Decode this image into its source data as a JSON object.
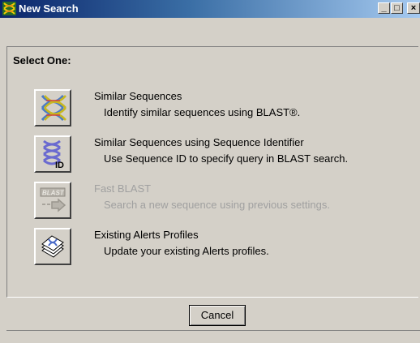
{
  "window": {
    "title": "New Search",
    "controls": {
      "minimize": "_",
      "maximize": "□",
      "close": "×"
    }
  },
  "heading": "Select One:",
  "options": [
    {
      "title": "Similar Sequences",
      "description": "Identify similar sequences using BLAST®.",
      "icon": "dna-helix-icon",
      "enabled": true
    },
    {
      "title": "Similar Sequences using Sequence Identifier",
      "description": "Use Sequence ID to specify query in BLAST search.",
      "icon": "dna-id-icon",
      "enabled": true
    },
    {
      "title": "Fast BLAST",
      "description": "Search a new sequence using previous settings.",
      "icon": "blast-arrow-icon",
      "icon_text": "BLAST",
      "enabled": false
    },
    {
      "title": "Existing Alerts Profiles",
      "description": "Update your existing Alerts profiles.",
      "icon": "alerts-profile-icon",
      "enabled": true
    }
  ],
  "footer": {
    "cancel_label": "Cancel"
  },
  "colors": {
    "title_bar_start": "#0a246a",
    "title_bar_end": "#a6caf0",
    "face": "#d4d0c8",
    "disabled_text": "#a0a0a0"
  }
}
